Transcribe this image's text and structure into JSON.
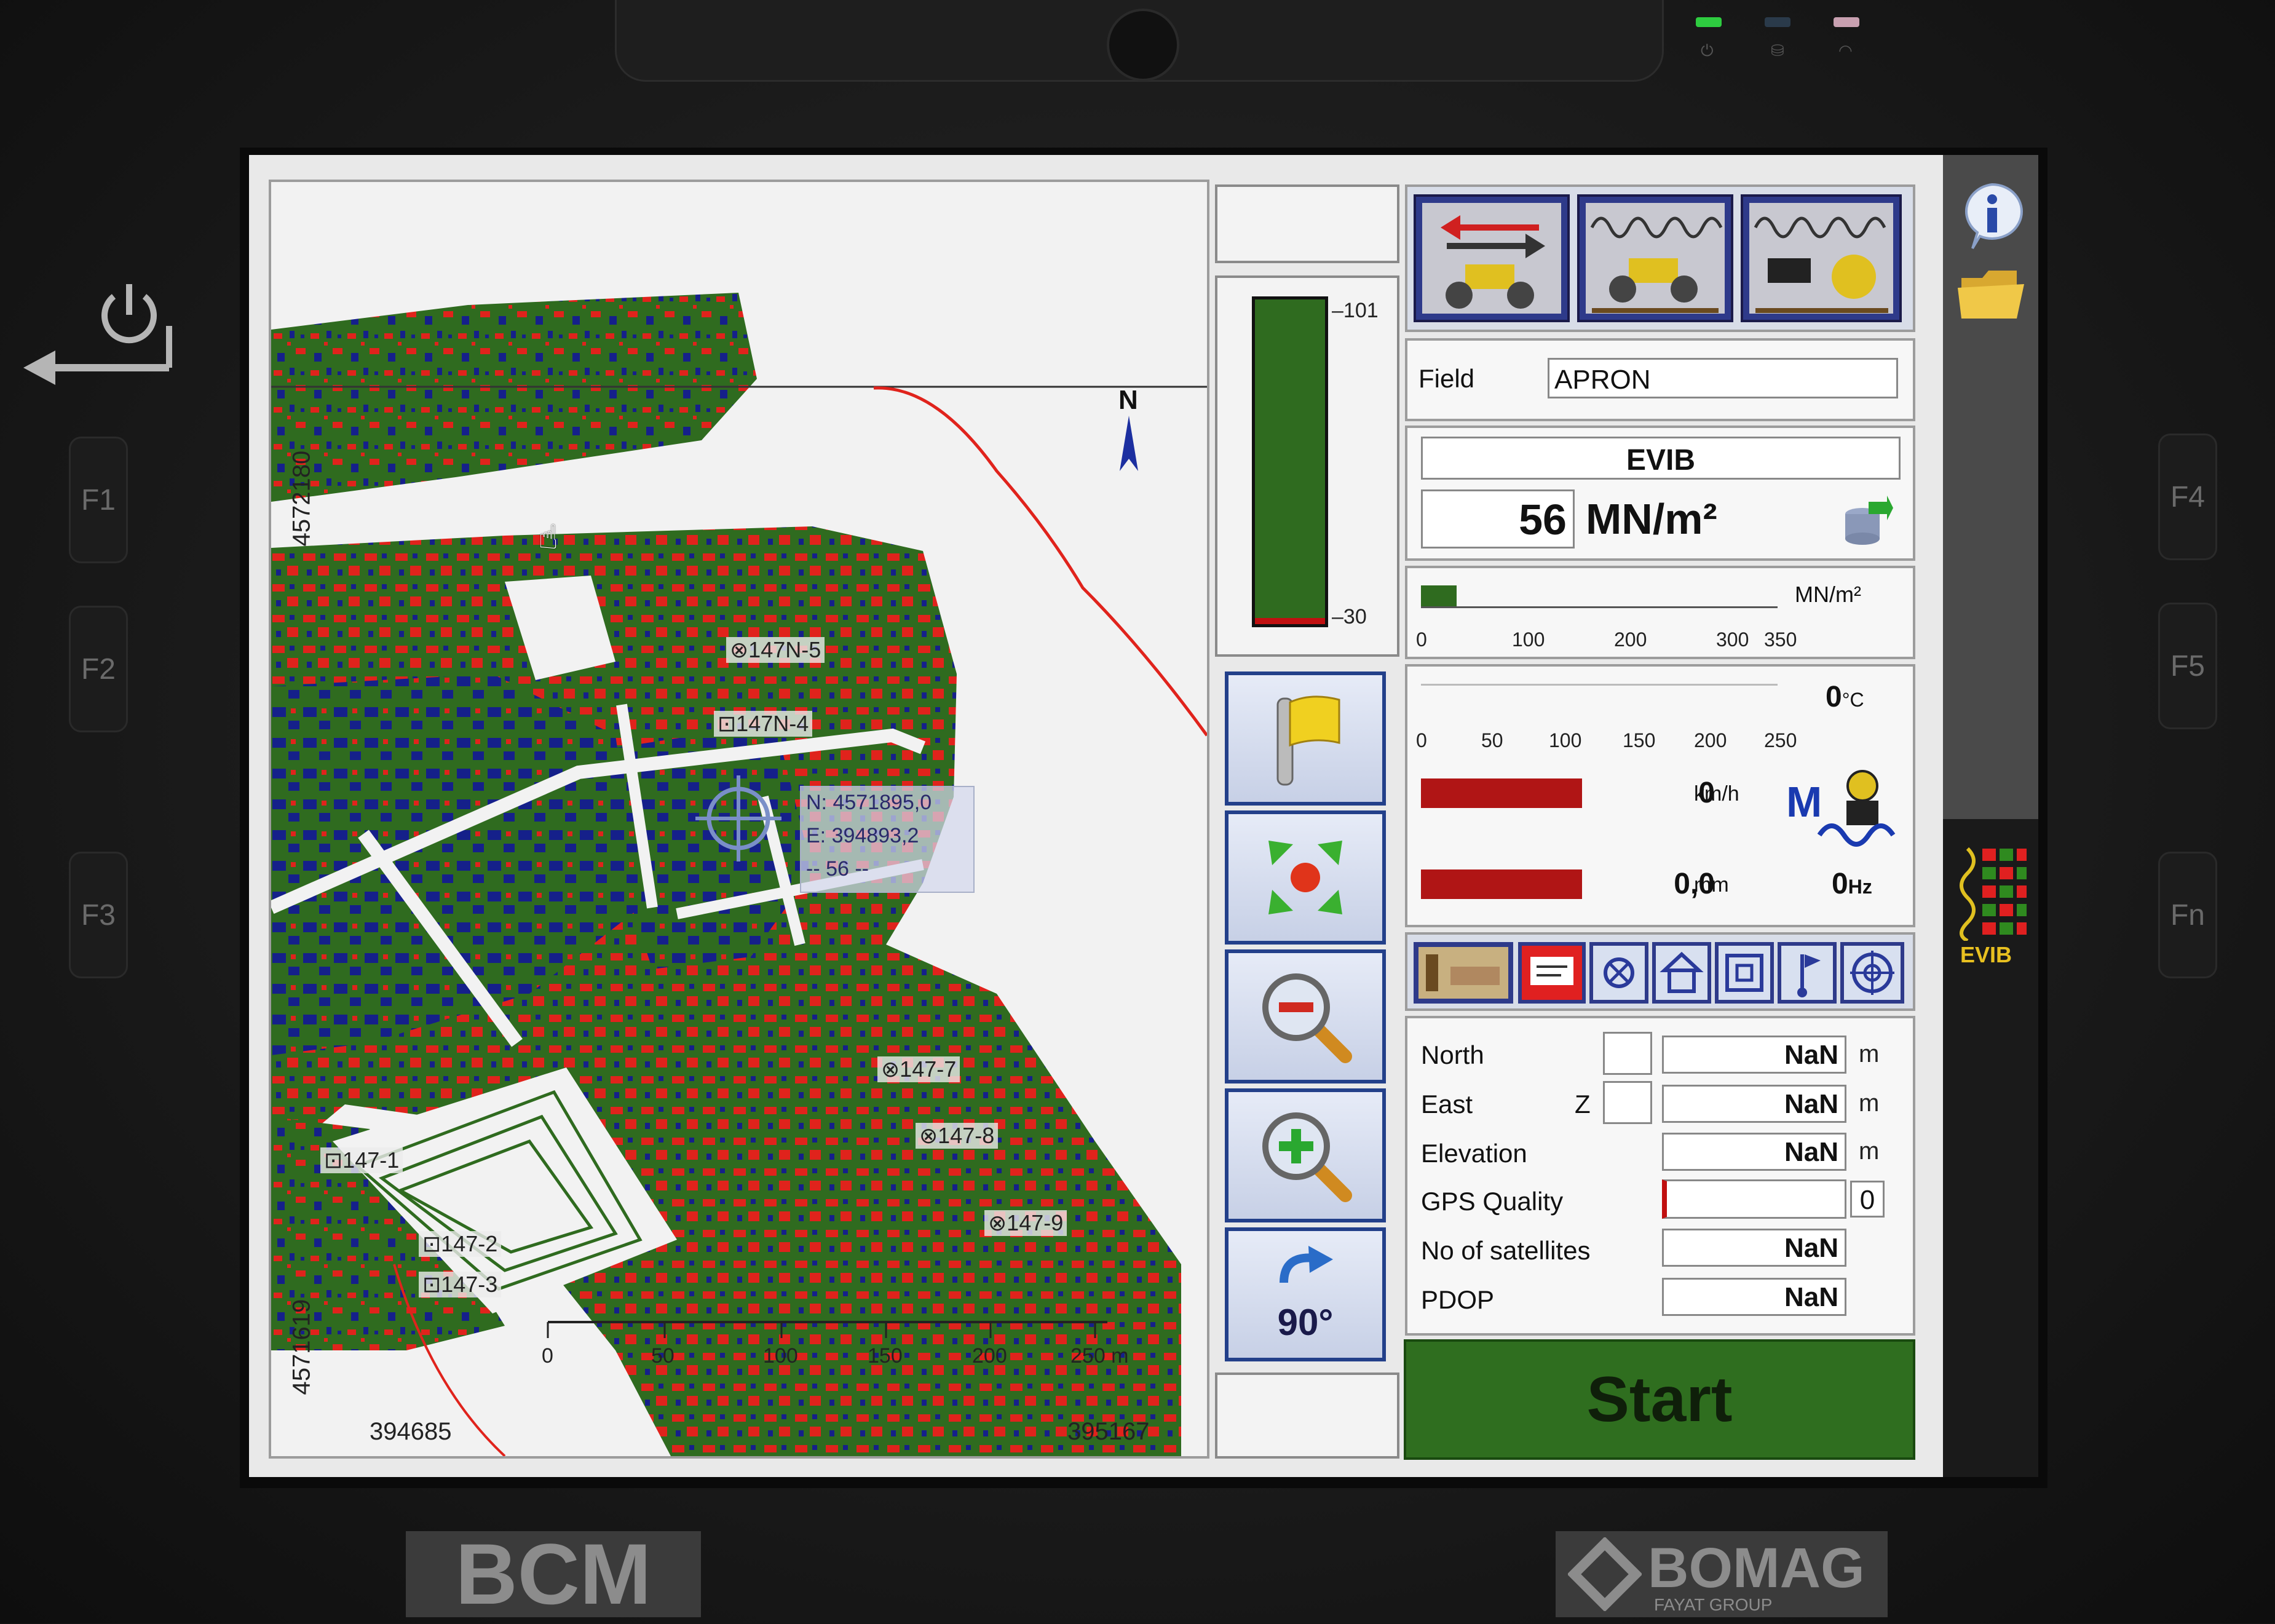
{
  "device": {
    "fkeys": [
      "F1",
      "F2",
      "F3",
      "F4",
      "F5",
      "Fn"
    ],
    "brand_left": "BCM",
    "brand_right": "BOMAG",
    "brand_sub": "FAYAT GROUP"
  },
  "map": {
    "north_label": "N",
    "coord_top_left": "4572180",
    "coord_bottom_left": "4571619",
    "coord_bottom_x_left": "394685",
    "coord_bottom_x_right": "395167",
    "scale_ticks": [
      "0",
      "50",
      "100",
      "150",
      "200",
      "250 m"
    ],
    "cursor_info": [
      "N: 4571895,0",
      "E: 394893,2",
      "-- 56 --"
    ],
    "markers": [
      "147N-5",
      "147N-4",
      "147-7",
      "147-8",
      "147-9",
      "147-1",
      "147-2",
      "147-3"
    ]
  },
  "legend_bar": {
    "max": "101",
    "min": "30"
  },
  "toolbar": {
    "rotate_label": "90°"
  },
  "field": {
    "label": "Field",
    "value": "APRON"
  },
  "measure": {
    "name": "EVIB",
    "value": "56",
    "unit": "MN/m²"
  },
  "scale1": {
    "unit": "MN/m²",
    "ticks": [
      "0",
      "100",
      "200",
      "300",
      "350"
    ],
    "fill_fraction": 0.1
  },
  "scale2": {
    "temp_value": "0",
    "temp_unit": "°C",
    "ticks": [
      "0",
      "50",
      "100",
      "150",
      "200",
      "250"
    ]
  },
  "speed": {
    "value": "0",
    "unit": "km/h"
  },
  "amplitude": {
    "value": "0,0",
    "unit": "mm"
  },
  "frequency": {
    "value": "0",
    "unit": "Hz"
  },
  "gps": {
    "north_label": "North",
    "north_value": "NaN",
    "north_unit": "m",
    "east_label": "East",
    "east_z": "Z",
    "east_value": "NaN",
    "east_unit": "m",
    "elev_label": "Elevation",
    "elev_value": "NaN",
    "elev_unit": "m",
    "quality_label": "GPS Quality",
    "quality_value": "0",
    "sats_label": "No of satellites",
    "sats_value": "NaN",
    "pdop_label": "PDOP",
    "pdop_value": "NaN"
  },
  "start_label": "Start",
  "sidebar": {
    "evib_label": "EVIB"
  },
  "colors": {
    "map_green": "#2f6b1f",
    "map_red": "#e0231c",
    "map_blue": "#15208a",
    "start_green": "#2f6e1f",
    "bar_red": "#b01515"
  }
}
